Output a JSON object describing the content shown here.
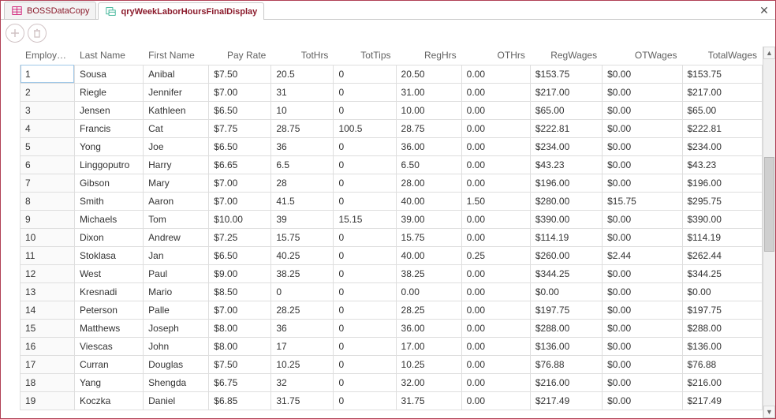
{
  "tabs": [
    {
      "label": "BOSSDataCopy",
      "active": false
    },
    {
      "label": "qryWeekLaborHoursFinalDisplay",
      "active": true
    }
  ],
  "columns": [
    "Employee ID",
    "Last Name",
    "First Name",
    "Pay Rate",
    "TotHrs",
    "TotTips",
    "RegHrs",
    "OTHrs",
    "RegWages",
    "OTWages",
    "TotalWages"
  ],
  "rows": [
    {
      "id": "1",
      "last": "Sousa",
      "first": "Anibal",
      "rate": "$7.50",
      "tothrs": "20.5",
      "tottips": "0",
      "reghrs": "20.50",
      "othrs": "0.00",
      "regw": "$153.75",
      "otw": "$0.00",
      "totw": "$153.75"
    },
    {
      "id": "2",
      "last": "Riegle",
      "first": "Jennifer",
      "rate": "$7.00",
      "tothrs": "31",
      "tottips": "0",
      "reghrs": "31.00",
      "othrs": "0.00",
      "regw": "$217.00",
      "otw": "$0.00",
      "totw": "$217.00"
    },
    {
      "id": "3",
      "last": "Jensen",
      "first": "Kathleen",
      "rate": "$6.50",
      "tothrs": "10",
      "tottips": "0",
      "reghrs": "10.00",
      "othrs": "0.00",
      "regw": "$65.00",
      "otw": "$0.00",
      "totw": "$65.00"
    },
    {
      "id": "4",
      "last": "Francis",
      "first": "Cat",
      "rate": "$7.75",
      "tothrs": "28.75",
      "tottips": "100.5",
      "reghrs": "28.75",
      "othrs": "0.00",
      "regw": "$222.81",
      "otw": "$0.00",
      "totw": "$222.81"
    },
    {
      "id": "5",
      "last": "Yong",
      "first": "Joe",
      "rate": "$6.50",
      "tothrs": "36",
      "tottips": "0",
      "reghrs": "36.00",
      "othrs": "0.00",
      "regw": "$234.00",
      "otw": "$0.00",
      "totw": "$234.00"
    },
    {
      "id": "6",
      "last": "Linggoputro",
      "first": "Harry",
      "rate": "$6.65",
      "tothrs": "6.5",
      "tottips": "0",
      "reghrs": "6.50",
      "othrs": "0.00",
      "regw": "$43.23",
      "otw": "$0.00",
      "totw": "$43.23"
    },
    {
      "id": "7",
      "last": "Gibson",
      "first": "Mary",
      "rate": "$7.00",
      "tothrs": "28",
      "tottips": "0",
      "reghrs": "28.00",
      "othrs": "0.00",
      "regw": "$196.00",
      "otw": "$0.00",
      "totw": "$196.00"
    },
    {
      "id": "8",
      "last": "Smith",
      "first": "Aaron",
      "rate": "$7.00",
      "tothrs": "41.5",
      "tottips": "0",
      "reghrs": "40.00",
      "othrs": "1.50",
      "regw": "$280.00",
      "otw": "$15.75",
      "totw": "$295.75"
    },
    {
      "id": "9",
      "last": "Michaels",
      "first": "Tom",
      "rate": "$10.00",
      "tothrs": "39",
      "tottips": "15.15",
      "reghrs": "39.00",
      "othrs": "0.00",
      "regw": "$390.00",
      "otw": "$0.00",
      "totw": "$390.00"
    },
    {
      "id": "10",
      "last": "Dixon",
      "first": "Andrew",
      "rate": "$7.25",
      "tothrs": "15.75",
      "tottips": "0",
      "reghrs": "15.75",
      "othrs": "0.00",
      "regw": "$114.19",
      "otw": "$0.00",
      "totw": "$114.19"
    },
    {
      "id": "11",
      "last": "Stoklasa",
      "first": "Jan",
      "rate": "$6.50",
      "tothrs": "40.25",
      "tottips": "0",
      "reghrs": "40.00",
      "othrs": "0.25",
      "regw": "$260.00",
      "otw": "$2.44",
      "totw": "$262.44"
    },
    {
      "id": "12",
      "last": "West",
      "first": "Paul",
      "rate": "$9.00",
      "tothrs": "38.25",
      "tottips": "0",
      "reghrs": "38.25",
      "othrs": "0.00",
      "regw": "$344.25",
      "otw": "$0.00",
      "totw": "$344.25"
    },
    {
      "id": "13",
      "last": "Kresnadi",
      "first": "Mario",
      "rate": "$8.50",
      "tothrs": "0",
      "tottips": "0",
      "reghrs": "0.00",
      "othrs": "0.00",
      "regw": "$0.00",
      "otw": "$0.00",
      "totw": "$0.00"
    },
    {
      "id": "14",
      "last": "Peterson",
      "first": "Palle",
      "rate": "$7.00",
      "tothrs": "28.25",
      "tottips": "0",
      "reghrs": "28.25",
      "othrs": "0.00",
      "regw": "$197.75",
      "otw": "$0.00",
      "totw": "$197.75"
    },
    {
      "id": "15",
      "last": "Matthews",
      "first": "Joseph",
      "rate": "$8.00",
      "tothrs": "36",
      "tottips": "0",
      "reghrs": "36.00",
      "othrs": "0.00",
      "regw": "$288.00",
      "otw": "$0.00",
      "totw": "$288.00"
    },
    {
      "id": "16",
      "last": "Viescas",
      "first": "John",
      "rate": "$8.00",
      "tothrs": "17",
      "tottips": "0",
      "reghrs": "17.00",
      "othrs": "0.00",
      "regw": "$136.00",
      "otw": "$0.00",
      "totw": "$136.00"
    },
    {
      "id": "17",
      "last": "Curran",
      "first": "Douglas",
      "rate": "$7.50",
      "tothrs": "10.25",
      "tottips": "0",
      "reghrs": "10.25",
      "othrs": "0.00",
      "regw": "$76.88",
      "otw": "$0.00",
      "totw": "$76.88"
    },
    {
      "id": "18",
      "last": "Yang",
      "first": "Shengda",
      "rate": "$6.75",
      "tothrs": "32",
      "tottips": "0",
      "reghrs": "32.00",
      "othrs": "0.00",
      "regw": "$216.00",
      "otw": "$0.00",
      "totw": "$216.00"
    },
    {
      "id": "19",
      "last": "Koczka",
      "first": "Daniel",
      "rate": "$6.85",
      "tothrs": "31.75",
      "tottips": "0",
      "reghrs": "31.75",
      "othrs": "0.00",
      "regw": "$217.49",
      "otw": "$0.00",
      "totw": "$217.49"
    }
  ]
}
